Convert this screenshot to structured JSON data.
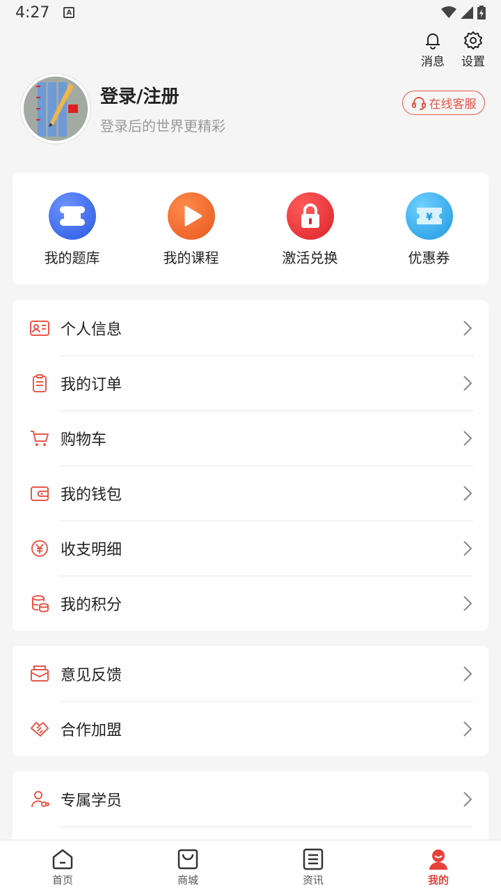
{
  "status_bar": {
    "time": "4:27"
  },
  "top_actions": {
    "messages_label": "消息",
    "settings_label": "设置"
  },
  "profile": {
    "login_title": "登录/注册",
    "login_subtitle": "登录后的世界更精彩"
  },
  "service_button": {
    "label": "在线客服"
  },
  "quick_actions": [
    {
      "label": "我的题库",
      "icon": "question-bank-icon",
      "color": "#3d6ff0"
    },
    {
      "label": "我的课程",
      "icon": "play-icon",
      "color": "#f26a2c"
    },
    {
      "label": "激活兑换",
      "icon": "lock-icon",
      "color": "#e8333a"
    },
    {
      "label": "优惠券",
      "icon": "coupon-icon",
      "color": "#2ba8ea"
    }
  ],
  "menu_group1": [
    {
      "label": "个人信息",
      "icon": "id-card-icon"
    },
    {
      "label": "我的订单",
      "icon": "clipboard-icon"
    },
    {
      "label": "购物车",
      "icon": "cart-icon"
    },
    {
      "label": "我的钱包",
      "icon": "wallet-icon"
    },
    {
      "label": "收支明细",
      "icon": "yuan-circle-icon"
    },
    {
      "label": "我的积分",
      "icon": "coins-icon"
    }
  ],
  "menu_group2": [
    {
      "label": "意见反馈",
      "icon": "feedback-mail-icon"
    },
    {
      "label": "合作加盟",
      "icon": "handshake-icon"
    }
  ],
  "menu_group3": [
    {
      "label": "专属学员",
      "icon": "student-icon"
    }
  ],
  "bottom_nav": [
    {
      "label": "首页",
      "icon": "home-icon",
      "active": false
    },
    {
      "label": "商城",
      "icon": "shop-bag-icon",
      "active": false
    },
    {
      "label": "资讯",
      "icon": "news-icon",
      "active": false
    },
    {
      "label": "我的",
      "icon": "profile-icon",
      "active": true
    }
  ],
  "colors": {
    "accent": "#e8574a",
    "active_tab": "#e8403a",
    "background": "#f5f5f5"
  }
}
